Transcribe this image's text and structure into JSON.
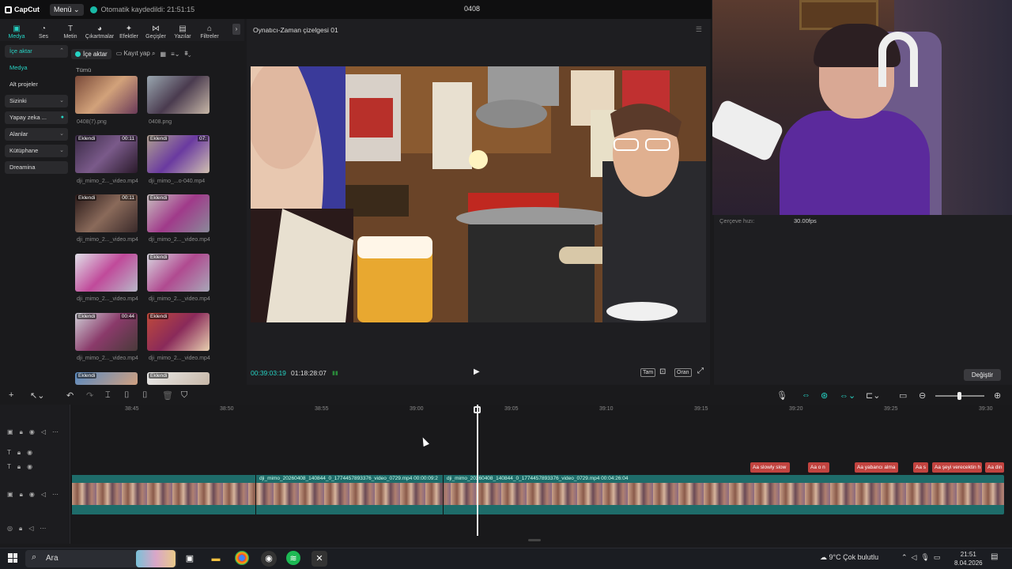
{
  "app": {
    "logo": "CapCut",
    "menu_label": "Menü",
    "autosave": "Otomatik kaydedildi: 21:51:15",
    "project": "0408"
  },
  "toolbar_tabs": [
    {
      "label": "Medya",
      "icon": "media-icon"
    },
    {
      "label": "Ses",
      "icon": "audio-icon"
    },
    {
      "label": "Metin",
      "icon": "text-icon"
    },
    {
      "label": "Çıkartmalar",
      "icon": "sticker-icon"
    },
    {
      "label": "Efektler",
      "icon": "effects-icon"
    },
    {
      "label": "Geçişler",
      "icon": "transitions-icon"
    },
    {
      "label": "Yazılar",
      "icon": "captions-icon"
    },
    {
      "label": "Filtreler",
      "icon": "filters-icon"
    }
  ],
  "nav": [
    {
      "label": "İçe aktar"
    },
    {
      "label": "Medya"
    },
    {
      "label": "Alt projeler"
    },
    {
      "label": "Sizinki"
    },
    {
      "label": "Yapay zeka ..."
    },
    {
      "label": "Alanlar"
    },
    {
      "label": "Kütüphane"
    },
    {
      "label": "Dreamina"
    }
  ],
  "media": {
    "import_label": "İçe aktar",
    "record_label": "Kayıt yap",
    "all_label": "Tümü",
    "items": [
      {
        "name": "0408(7).png",
        "tag": "",
        "dur": ""
      },
      {
        "name": "0408.png",
        "tag": "",
        "dur": ""
      },
      {
        "name": "dji_mimo_2..._video.mp4",
        "tag": "Eklendi",
        "dur": "00:11"
      },
      {
        "name": "dji_mimo_...o-040.mp4",
        "tag": "Eklendi",
        "dur": "07:"
      },
      {
        "name": "dji_mimo_2..._video.mp4",
        "tag": "Eklendi",
        "dur": "00:11"
      },
      {
        "name": "dji_mimo_2..._video.mp4",
        "tag": "Eklendi",
        "dur": ""
      },
      {
        "name": "dji_mimo_2..._video.mp4",
        "tag": "",
        "dur": ""
      },
      {
        "name": "dji_mimo_2..._video.mp4",
        "tag": "Eklendi",
        "dur": ""
      },
      {
        "name": "dji_mimo_2..._video.mp4",
        "tag": "Eklendi",
        "dur": "00:44"
      },
      {
        "name": "dji_mimo_2..._video.mp4",
        "tag": "Eklendi",
        "dur": ""
      },
      {
        "name": "",
        "tag": "Eklendi",
        "dur": ""
      },
      {
        "name": "",
        "tag": "Eklendi",
        "dur": ""
      }
    ]
  },
  "player": {
    "title": "Oynatıcı-Zaman çizelgesi 01",
    "current_time": "00:39:03:19",
    "total_time": "01:18:28:07",
    "btn_full": "Tam",
    "btn_ratio": "Oran"
  },
  "props": {
    "fps_label": "Çerçeve hızı:",
    "fps_value": "30.00fps",
    "change_label": "Değiştir"
  },
  "ruler": [
    "38:45",
    "38:50",
    "38:55",
    "39:00",
    "39:05",
    "39:10",
    "39:15",
    "39:20",
    "39:25",
    "39:30"
  ],
  "clips": [
    {
      "label": "dji_mimo_20260408_140844_0_1774457893376_video_0729.mp4   00:00:09:2"
    },
    {
      "label": "dji_mimo_20260408_140844_0_1774457893376_video_0729.mp4   00:04:26:04"
    }
  ],
  "subtitles": [
    "slowly slow",
    "o n",
    "yabancı alma",
    "s",
    "şeyi verecektin h",
    "din"
  ],
  "taskbar": {
    "search": "Ara",
    "weather": "9°C  Çok bulutlu",
    "time": "21:51",
    "date": "8.04.2026"
  }
}
